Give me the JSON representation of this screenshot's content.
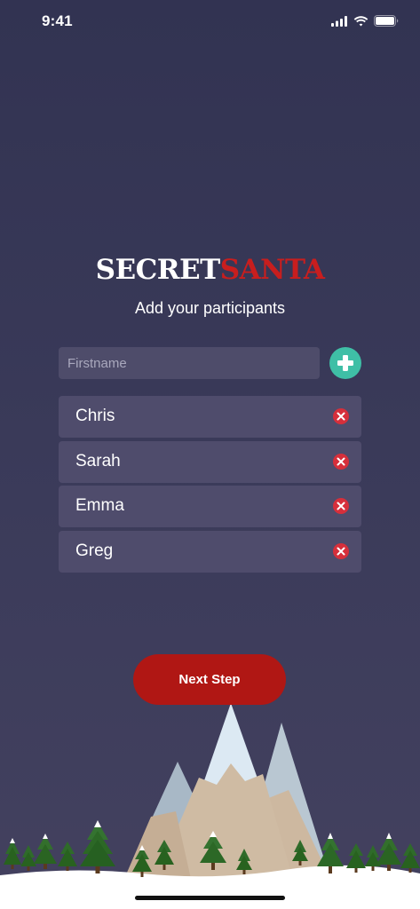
{
  "status_bar": {
    "time": "9:41"
  },
  "logo": {
    "secret": "SECRET",
    "santa": "SANTA"
  },
  "subtitle": "Add your participants",
  "input": {
    "placeholder": "Firstname",
    "value": ""
  },
  "participants": [
    {
      "name": "Chris"
    },
    {
      "name": "Sarah"
    },
    {
      "name": "Emma"
    },
    {
      "name": "Greg"
    }
  ],
  "next_button": {
    "label": "Next Step"
  },
  "colors": {
    "background": "#3b3b5a",
    "accent_red": "#b01714",
    "add_green": "#3fbfa6",
    "remove_red": "#d62f3b",
    "row_bg": "#4f4c6c"
  },
  "icons": {
    "add": "plus-circle-icon",
    "remove": "x-circle-icon",
    "signal": "cellular-signal-icon",
    "wifi": "wifi-icon",
    "battery": "battery-icon"
  }
}
